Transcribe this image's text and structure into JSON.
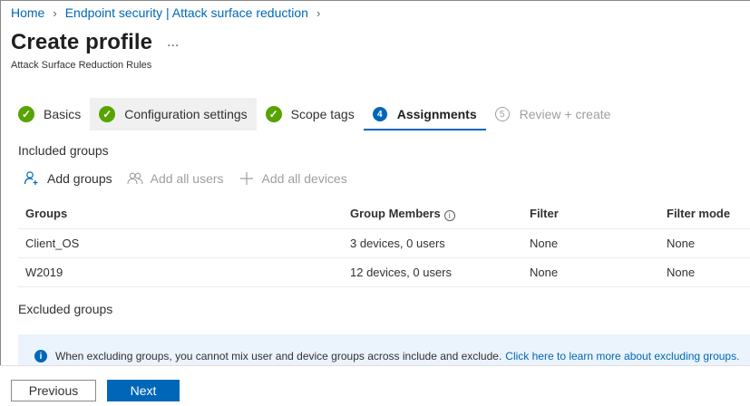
{
  "breadcrumb": {
    "items": [
      {
        "label": "Home"
      },
      {
        "label": "Endpoint security | Attack surface reduction"
      }
    ]
  },
  "header": {
    "title": "Create profile",
    "more_label": "...",
    "subtitle": "Attack Surface Reduction Rules"
  },
  "steps": [
    {
      "label": "Basics",
      "state": "complete"
    },
    {
      "label": "Configuration settings",
      "state": "complete"
    },
    {
      "label": "Scope tags",
      "state": "complete"
    },
    {
      "label": "Assignments",
      "number": "4",
      "state": "active"
    },
    {
      "label": "Review + create",
      "number": "5",
      "state": "disabled"
    }
  ],
  "included": {
    "label": "Included groups",
    "commands": {
      "add_groups": "Add groups",
      "add_all_users": "Add all users",
      "add_all_devices": "Add all devices"
    },
    "table": {
      "columns": [
        "Groups",
        "Group Members",
        "Filter",
        "Filter mode"
      ],
      "info_icon": "i",
      "rows": [
        {
          "group": "Client_OS",
          "members": "3 devices, 0 users",
          "filter": "None",
          "filter_mode": "None"
        },
        {
          "group": "W2019",
          "members": "12 devices, 0 users",
          "filter": "None",
          "filter_mode": "None"
        }
      ]
    }
  },
  "excluded": {
    "label": "Excluded groups",
    "info_icon": "i",
    "info_text": "When excluding groups, you cannot mix user and device groups across include and exclude.",
    "info_link": "Click here to learn more about excluding groups."
  },
  "footer": {
    "previous_label": "Previous",
    "next_label": "Next"
  },
  "colors": {
    "accent": "#0067b8",
    "success": "#57a300",
    "disabled": "#a19f9d"
  }
}
